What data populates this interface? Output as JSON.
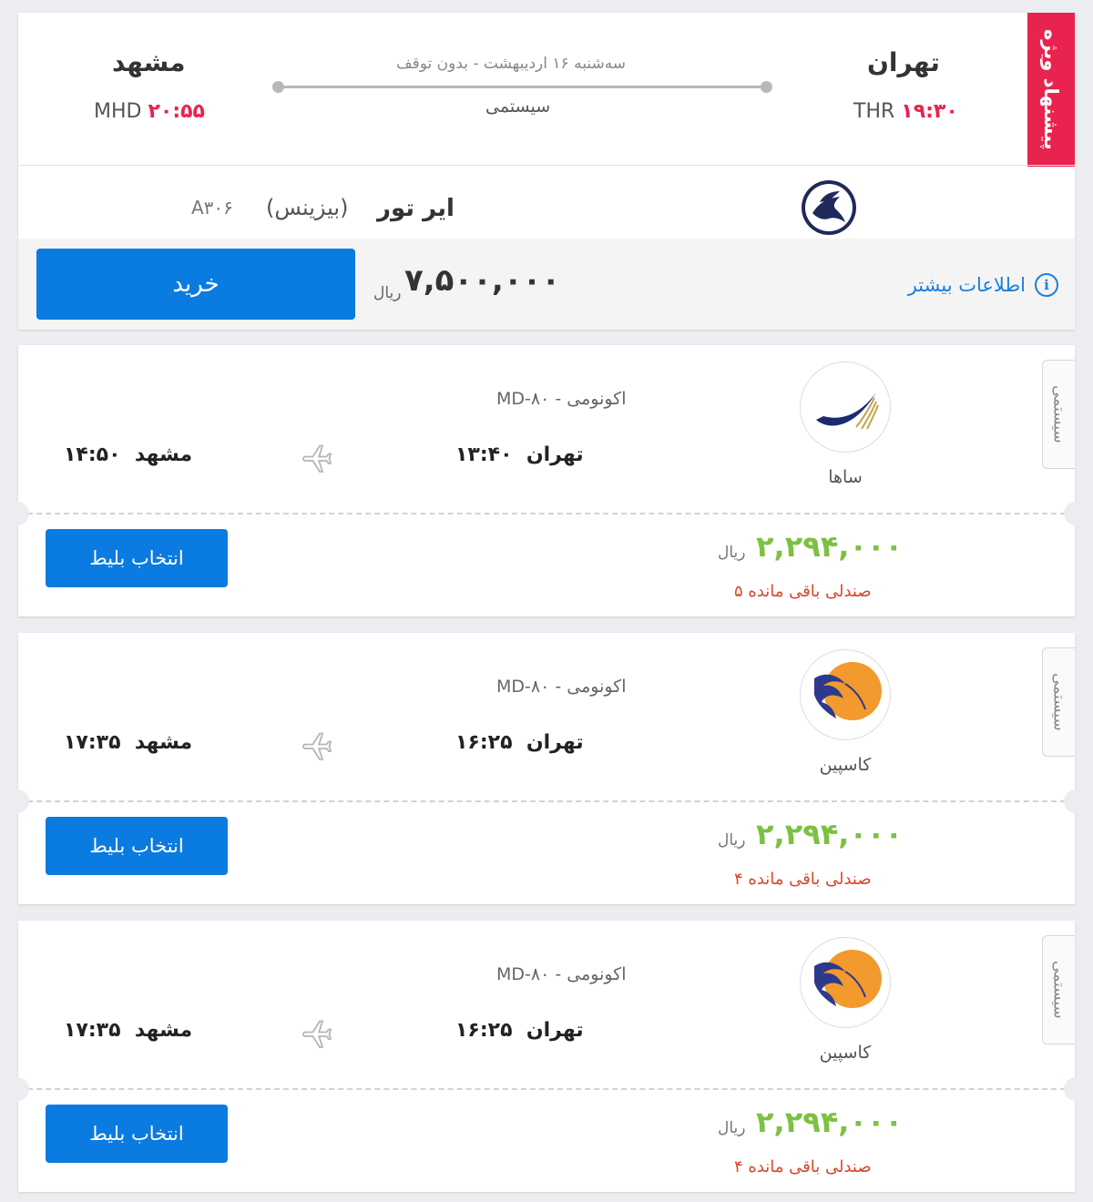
{
  "featured": {
    "badge": "پیشنهاد ویژه",
    "origin_city": "تهران",
    "origin_code": "THR",
    "origin_time": "۱۹:۳۰",
    "dest_city": "مشهد",
    "dest_code": "MHD",
    "dest_time": "۲۰:۵۵",
    "route_info": "سه‌شنبه ۱۶ اردیبهشت - بدون توقف",
    "system_label": "سیستمی",
    "airline_name": "ایر تور",
    "class_label": "(بیزینس)",
    "flight_number": "A۳۰۶",
    "price": "۷,۵۰۰,۰۰۰",
    "currency": "ریال",
    "buy_label": "خرید",
    "more_info": "اطلاعات بیشتر",
    "logo_icon": "pegasus-icon"
  },
  "flights": [
    {
      "system_tag": "سیستمی",
      "airline": "ساها",
      "logo_icon": "saha-wing-icon",
      "aircraft": "MD-۸۰ - اکونومی",
      "from_city": "تهران",
      "from_time": "۱۳:۴۰",
      "to_city": "مشهد",
      "to_time": "۱۴:۵۰",
      "price": "۲,۲۹۴,۰۰۰",
      "currency": "ریال",
      "seats": "۵ صندلی باقی مانده",
      "select_label": "انتخاب بلیط"
    },
    {
      "system_tag": "سیستمی",
      "airline": "کاسپین",
      "logo_icon": "caspian-bird-icon",
      "aircraft": "MD-۸۰ - اکونومی",
      "from_city": "تهران",
      "from_time": "۱۶:۲۵",
      "to_city": "مشهد",
      "to_time": "۱۷:۳۵",
      "price": "۲,۲۹۴,۰۰۰",
      "currency": "ریال",
      "seats": "۴ صندلی باقی مانده",
      "select_label": "انتخاب بلیط"
    },
    {
      "system_tag": "سیستمی",
      "airline": "کاسپین",
      "logo_icon": "caspian-bird-icon",
      "aircraft": "MD-۸۰ - اکونومی",
      "from_city": "تهران",
      "from_time": "۱۶:۲۵",
      "to_city": "مشهد",
      "to_time": "۱۷:۳۵",
      "price": "۲,۲۹۴,۰۰۰",
      "currency": "ریال",
      "seats": "۴ صندلی باقی مانده",
      "select_label": "انتخاب بلیط"
    }
  ],
  "colors": {
    "accent_blue": "#0a7be0",
    "special_red": "#e8234f",
    "price_green": "#7cc142",
    "seats_orange": "#d9462b"
  }
}
